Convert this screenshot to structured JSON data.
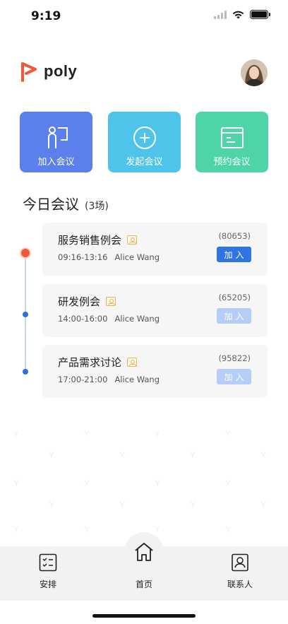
{
  "status_bar": {
    "time": "9:19"
  },
  "header": {
    "logo_text": "poly"
  },
  "actions": [
    {
      "label": "加入会议",
      "icon": "join-meeting-icon",
      "color": "#5b80ec"
    },
    {
      "label": "发起会议",
      "icon": "add-circle-icon",
      "color": "#4fc4ea"
    },
    {
      "label": "预约会议",
      "icon": "calendar-icon",
      "color": "#4fd4a8"
    }
  ],
  "today": {
    "title": "今日会议",
    "count": "(3场)"
  },
  "meetings": [
    {
      "title": "服务销售例会",
      "time": "09:16-13:16",
      "host": "Alice Wang",
      "id": "(80653)",
      "button": "加入",
      "button_enabled": true
    },
    {
      "title": "研发例会",
      "time": "14:00-16:00",
      "host": "Alice Wang",
      "id": "(65205)",
      "button": "加入",
      "button_enabled": false
    },
    {
      "title": "产品需求讨论",
      "time": "17:00-21:00",
      "host": "Alice Wang",
      "id": "(95822)",
      "button": "加入",
      "button_enabled": false
    }
  ],
  "bottom_nav": [
    {
      "label": "安排",
      "icon": "schedule-icon"
    },
    {
      "label": "首页",
      "icon": "home-icon",
      "active": true
    },
    {
      "label": "联系人",
      "icon": "contacts-icon"
    }
  ],
  "colors": {
    "accent_blue": "#2f73e4",
    "brand_orange": "#f05a3a"
  }
}
